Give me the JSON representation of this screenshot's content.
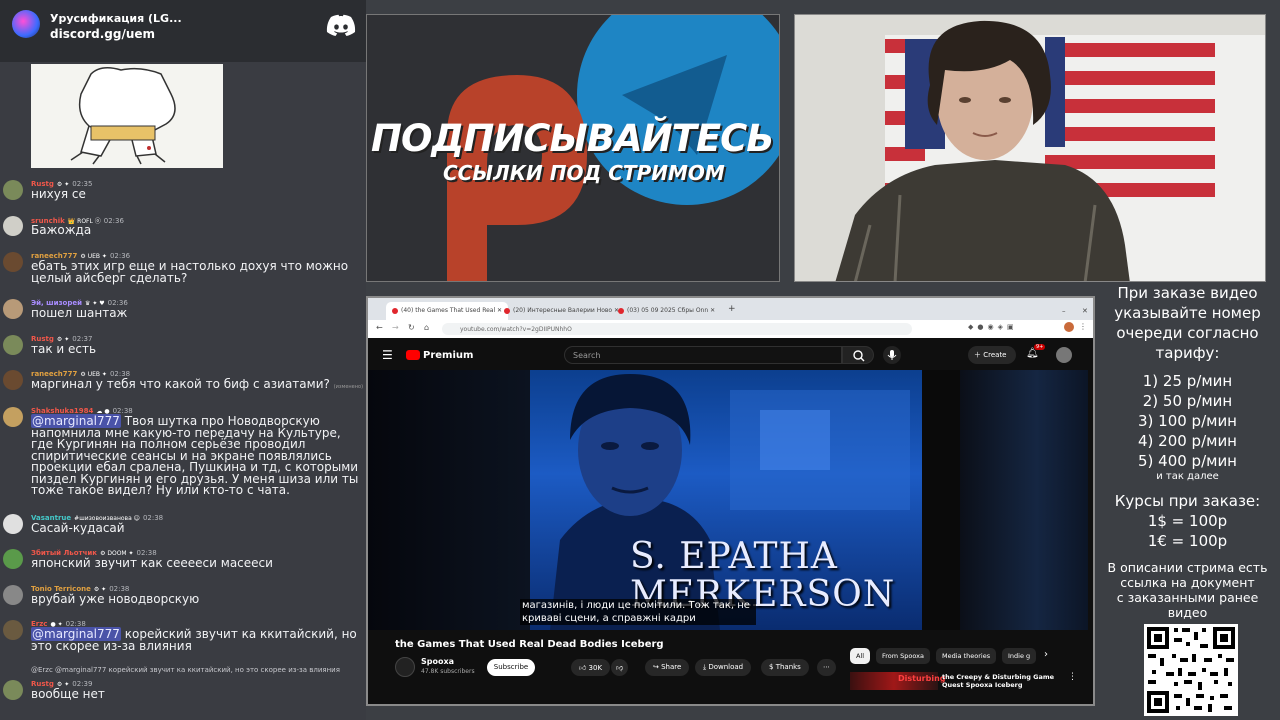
{
  "discord": {
    "server_name": "Урусификация (LG...",
    "invite": "discord.gg/uem"
  },
  "chat": {
    "messages": [
      {
        "nick": "Rustg",
        "nick_color": "#f0574a",
        "badges": "⚙︎ ✦",
        "time": "02:35",
        "text": "нихуя се"
      },
      {
        "nick": "srunchik",
        "nick_color": "#f0574a",
        "badges": "👑 ROFL ⓞ",
        "time": "02:36",
        "text": "Бажожда"
      },
      {
        "nick": "raneech777",
        "nick_color": "#e0a040",
        "badges": "⚙︎ UEB ✦",
        "time": "02:36",
        "text": "ебать этих игр еще и настолько дохуя что можно целый айсберг сделать?"
      },
      {
        "nick": "Эй, шизорей",
        "nick_color": "#a88cff",
        "badges": "♛ ✦ ♥",
        "time": "02:36",
        "text": "пошел шантаж"
      },
      {
        "nick": "Rustg",
        "nick_color": "#f0574a",
        "badges": "⚙︎ ✦",
        "time": "02:37",
        "text": "так и есть"
      },
      {
        "nick": "raneech777",
        "nick_color": "#e0a040",
        "badges": "⚙︎ UEB ✦",
        "time": "02:38",
        "text": "маргинал у тебя что какой то биф с азиатами?",
        "suffix": "(изменено)"
      },
      {
        "nick": "Shakshuka1984",
        "nick_color": "#f0574a",
        "badges": "☁ ●",
        "time": "02:38",
        "mention": "@marginal777",
        "text": "Твоя шутка про Новодворскую напомнила мне какую-то передачу на Культуре, где Кургинян на полном серьёзе проводил спиритические сеансы и на экране появлялись проекции ебал сралена, Пушкина и тд, с которыми пиздел Кургинян и его друзья. У меня шиза или ты тоже такое видел? Ну или кто-то с чата."
      },
      {
        "nick": "Vasantrue",
        "nick_color": "#44c8c8",
        "badges": "#шизовоизванова ☺",
        "time": "02:38",
        "text": "Сасай-кудасай"
      },
      {
        "nick": "Збитый Льотчик",
        "nick_color": "#f0574a",
        "badges": "⚙︎ DOOM ✦",
        "time": "02:38",
        "text": "японский звучит как сееееси масееси"
      },
      {
        "nick": "Tonio Terricone",
        "nick_color": "#e0a040",
        "badges": "⚙︎ ✦",
        "time": "02:38",
        "text": "врубай уже новодворскую"
      },
      {
        "nick": "Erzc",
        "nick_color": "#f0574a",
        "badges": "● ✦",
        "time": "02:38",
        "mention": "@marginal777",
        "text": "корейский звучит ка ккитайский, но это скорее из-за влияния"
      },
      {
        "nick": "Rustg",
        "nick_color": "#f0574a",
        "badges": "⚙︎ ✦",
        "time": "02:39",
        "reply": "@Erzc @marginal777 корейский звучит ка ккитайский, но это скорее из-за влияния",
        "text": "вообще нет"
      }
    ]
  },
  "promo": {
    "headline": "ПОДПИСЫВАЙТЕСЬ",
    "subline": "ССЫЛКИ ПОД СТРИМОМ"
  },
  "browser": {
    "tabs": [
      "(40) the Games That Used Real",
      "(20) Интересные Валерии Ново",
      "(03) 05 09 2025 Сбры Onn"
    ],
    "url": "youtube.com/watch?v=2gDIIPUNhhO"
  },
  "youtube": {
    "logo_text": "Premium",
    "search_placeholder": "Search",
    "create_label": "Create",
    "notif_count": "9+",
    "video_overlay_line1": "S. EPATHA",
    "video_overlay_line2": "MERKERSON",
    "subtitle_line1": "магазинів, і люди це помітили.  Тож так, не",
    "subtitle_line2": "криваві сцени, а справжні кадри",
    "video_title": "the Games That Used Real Dead Bodies Iceberg",
    "channel_name": "Spooxa",
    "channel_subs": "47.8K subscribers",
    "subscribe_label": "Subscribe",
    "likes": "30K",
    "share_label": "Share",
    "download_label": "Download",
    "thanks_label": "Thanks",
    "chips": [
      "All",
      "From Spooxa",
      "Media theories",
      "Indie g"
    ],
    "rec_title_1": "the Creepy & Disturbing Game",
    "rec_title_2": "Quest Spooxa Iceberg",
    "rec_thumb_text": "Disturbing"
  },
  "pricing": {
    "intro": [
      "При заказе видео",
      "указывайте номер",
      "очереди согласно",
      "тарифу:"
    ],
    "tiers": [
      "1) 25 р/мин",
      "2) 50 р/мин",
      "3) 100 р/мин",
      "4) 200 р/мин",
      "5) 400 р/мин"
    ],
    "tiers_more": "и так далее",
    "rates_title": "Курсы при заказе:",
    "rates": [
      "1$ = 100р",
      "1€ = 100р"
    ],
    "doc_note": [
      "В описании стрима есть",
      "ссылка на документ",
      "с заказанными ранее",
      "видео"
    ]
  }
}
